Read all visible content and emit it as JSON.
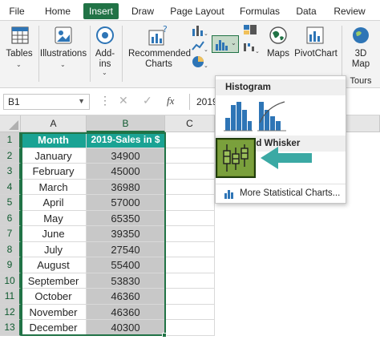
{
  "ribbon_tabs": [
    "File",
    "Home",
    "Insert",
    "Draw",
    "Page Layout",
    "Formulas",
    "Data",
    "Review"
  ],
  "active_tab": "Insert",
  "groups": {
    "tables": "Tables",
    "illustrations": "Illustrations",
    "addins_line1": "Add-",
    "addins_line2": "ins",
    "recommended_line1": "Recommended",
    "recommended_line2": "Charts",
    "maps": "Maps",
    "pivotchart": "PivotChart",
    "threed_line1": "3D",
    "threed_line2": "Map",
    "tours": "Tours"
  },
  "name_box": "B1",
  "formula_value": "2019",
  "formula_fx": "fx",
  "columns": [
    "A",
    "B",
    "C"
  ],
  "rows": [
    "1",
    "2",
    "3",
    "4",
    "5",
    "6",
    "7",
    "8",
    "9",
    "10",
    "11",
    "12",
    "13"
  ],
  "table": {
    "header_month": "Month",
    "header_sales": "2019-Sales in $",
    "months": [
      "January",
      "February",
      "March",
      "April",
      "May",
      "June",
      "July",
      "August",
      "September",
      "October",
      "November",
      "December"
    ],
    "sales": [
      "34900",
      "45000",
      "36980",
      "57000",
      "65350",
      "39350",
      "27540",
      "55400",
      "53830",
      "46360",
      "46360",
      "40300"
    ]
  },
  "dropdown": {
    "histogram_heading": "Histogram",
    "box_whisker_heading": "Box and Whisker",
    "more_charts": "More Statistical Charts..."
  },
  "colors": {
    "excel_green": "#217346",
    "header_fill": "#1aa394",
    "sales_fill": "#c8c8c8",
    "chart_blue": "#2e75b6",
    "box_whisker_fill": "#7aa03c",
    "arrow": "#3ba9a4"
  }
}
